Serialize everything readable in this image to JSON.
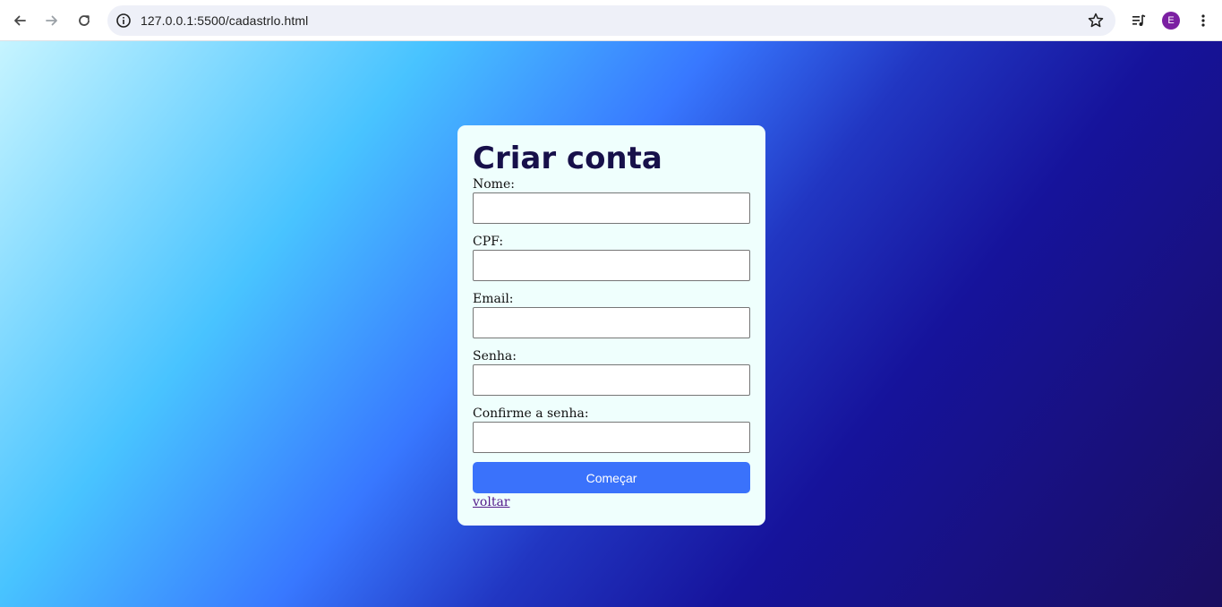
{
  "browser": {
    "url": "127.0.0.1:5500/cadastrlo.html",
    "avatar_letter": "E"
  },
  "form": {
    "title": "Criar conta",
    "fields": [
      {
        "label": "Nome:",
        "value": ""
      },
      {
        "label": "CPF:",
        "value": ""
      },
      {
        "label": "Email:",
        "value": ""
      },
      {
        "label": "Senha:",
        "value": ""
      },
      {
        "label": "Confirme a senha:",
        "value": ""
      }
    ],
    "submit_label": "Começar",
    "back_link": "voltar"
  },
  "colors": {
    "card_background": "#effffd",
    "button": "#3a72fb",
    "title": "#17104a",
    "link_visited": "#551a8b"
  }
}
